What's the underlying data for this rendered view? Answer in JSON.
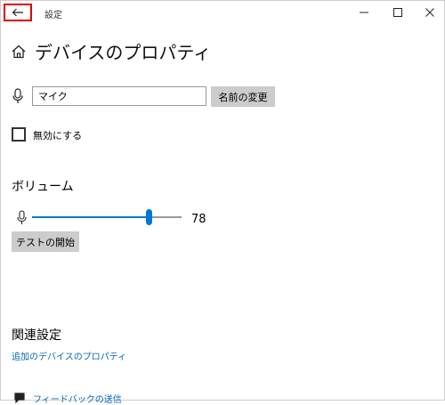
{
  "window": {
    "title": "設定"
  },
  "header": {
    "title": "デバイスのプロパティ"
  },
  "name_row": {
    "value": "マイク",
    "rename_button": "名前の変更"
  },
  "disable": {
    "label": "無効にする",
    "checked": false
  },
  "volume": {
    "heading": "ボリューム",
    "value": 78,
    "value_text": "78",
    "test_button": "テストの開始"
  },
  "related": {
    "heading": "関連設定",
    "link": "追加のデバイスのプロパティ"
  },
  "feedback": {
    "link": "フィードバックの送信"
  },
  "colors": {
    "accent": "#0078d7",
    "link": "#0066b4",
    "highlight_border": "#e00000",
    "button_bg": "#cccccc"
  },
  "icons": {
    "back": "back-arrow-icon",
    "minimize": "minimize-icon",
    "maximize": "maximize-icon",
    "close": "close-icon",
    "home": "home-icon",
    "microphone": "microphone-icon",
    "feedback": "feedback-icon"
  }
}
